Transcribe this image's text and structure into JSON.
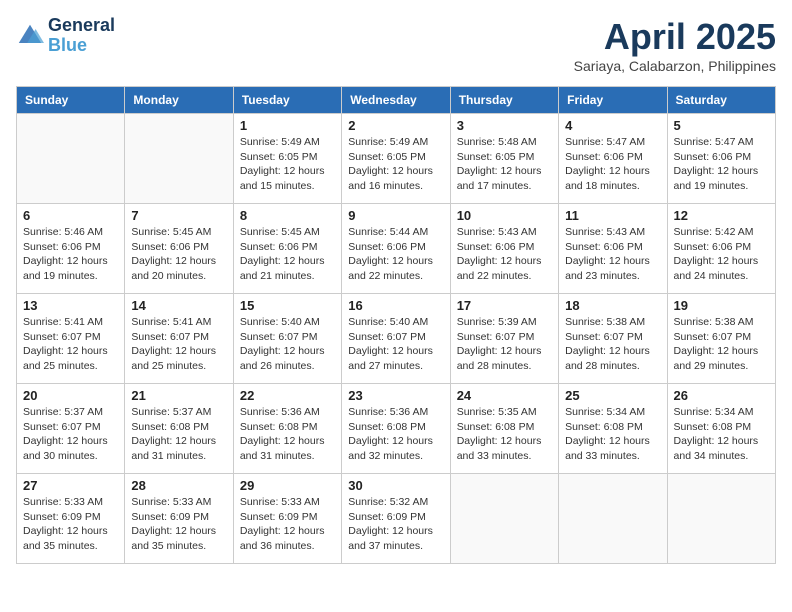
{
  "header": {
    "logo_line1": "General",
    "logo_line2": "Blue",
    "month": "April 2025",
    "location": "Sariaya, Calabarzon, Philippines"
  },
  "weekdays": [
    "Sunday",
    "Monday",
    "Tuesday",
    "Wednesday",
    "Thursday",
    "Friday",
    "Saturday"
  ],
  "weeks": [
    [
      null,
      null,
      {
        "day": 1,
        "sunrise": "5:49 AM",
        "sunset": "6:05 PM",
        "daylight": "12 hours and 15 minutes."
      },
      {
        "day": 2,
        "sunrise": "5:49 AM",
        "sunset": "6:05 PM",
        "daylight": "12 hours and 16 minutes."
      },
      {
        "day": 3,
        "sunrise": "5:48 AM",
        "sunset": "6:05 PM",
        "daylight": "12 hours and 17 minutes."
      },
      {
        "day": 4,
        "sunrise": "5:47 AM",
        "sunset": "6:06 PM",
        "daylight": "12 hours and 18 minutes."
      },
      {
        "day": 5,
        "sunrise": "5:47 AM",
        "sunset": "6:06 PM",
        "daylight": "12 hours and 19 minutes."
      }
    ],
    [
      {
        "day": 6,
        "sunrise": "5:46 AM",
        "sunset": "6:06 PM",
        "daylight": "12 hours and 19 minutes."
      },
      {
        "day": 7,
        "sunrise": "5:45 AM",
        "sunset": "6:06 PM",
        "daylight": "12 hours and 20 minutes."
      },
      {
        "day": 8,
        "sunrise": "5:45 AM",
        "sunset": "6:06 PM",
        "daylight": "12 hours and 21 minutes."
      },
      {
        "day": 9,
        "sunrise": "5:44 AM",
        "sunset": "6:06 PM",
        "daylight": "12 hours and 22 minutes."
      },
      {
        "day": 10,
        "sunrise": "5:43 AM",
        "sunset": "6:06 PM",
        "daylight": "12 hours and 22 minutes."
      },
      {
        "day": 11,
        "sunrise": "5:43 AM",
        "sunset": "6:06 PM",
        "daylight": "12 hours and 23 minutes."
      },
      {
        "day": 12,
        "sunrise": "5:42 AM",
        "sunset": "6:06 PM",
        "daylight": "12 hours and 24 minutes."
      }
    ],
    [
      {
        "day": 13,
        "sunrise": "5:41 AM",
        "sunset": "6:07 PM",
        "daylight": "12 hours and 25 minutes."
      },
      {
        "day": 14,
        "sunrise": "5:41 AM",
        "sunset": "6:07 PM",
        "daylight": "12 hours and 25 minutes."
      },
      {
        "day": 15,
        "sunrise": "5:40 AM",
        "sunset": "6:07 PM",
        "daylight": "12 hours and 26 minutes."
      },
      {
        "day": 16,
        "sunrise": "5:40 AM",
        "sunset": "6:07 PM",
        "daylight": "12 hours and 27 minutes."
      },
      {
        "day": 17,
        "sunrise": "5:39 AM",
        "sunset": "6:07 PM",
        "daylight": "12 hours and 28 minutes."
      },
      {
        "day": 18,
        "sunrise": "5:38 AM",
        "sunset": "6:07 PM",
        "daylight": "12 hours and 28 minutes."
      },
      {
        "day": 19,
        "sunrise": "5:38 AM",
        "sunset": "6:07 PM",
        "daylight": "12 hours and 29 minutes."
      }
    ],
    [
      {
        "day": 20,
        "sunrise": "5:37 AM",
        "sunset": "6:07 PM",
        "daylight": "12 hours and 30 minutes."
      },
      {
        "day": 21,
        "sunrise": "5:37 AM",
        "sunset": "6:08 PM",
        "daylight": "12 hours and 31 minutes."
      },
      {
        "day": 22,
        "sunrise": "5:36 AM",
        "sunset": "6:08 PM",
        "daylight": "12 hours and 31 minutes."
      },
      {
        "day": 23,
        "sunrise": "5:36 AM",
        "sunset": "6:08 PM",
        "daylight": "12 hours and 32 minutes."
      },
      {
        "day": 24,
        "sunrise": "5:35 AM",
        "sunset": "6:08 PM",
        "daylight": "12 hours and 33 minutes."
      },
      {
        "day": 25,
        "sunrise": "5:34 AM",
        "sunset": "6:08 PM",
        "daylight": "12 hours and 33 minutes."
      },
      {
        "day": 26,
        "sunrise": "5:34 AM",
        "sunset": "6:08 PM",
        "daylight": "12 hours and 34 minutes."
      }
    ],
    [
      {
        "day": 27,
        "sunrise": "5:33 AM",
        "sunset": "6:09 PM",
        "daylight": "12 hours and 35 minutes."
      },
      {
        "day": 28,
        "sunrise": "5:33 AM",
        "sunset": "6:09 PM",
        "daylight": "12 hours and 35 minutes."
      },
      {
        "day": 29,
        "sunrise": "5:33 AM",
        "sunset": "6:09 PM",
        "daylight": "12 hours and 36 minutes."
      },
      {
        "day": 30,
        "sunrise": "5:32 AM",
        "sunset": "6:09 PM",
        "daylight": "12 hours and 37 minutes."
      },
      null,
      null,
      null
    ]
  ]
}
